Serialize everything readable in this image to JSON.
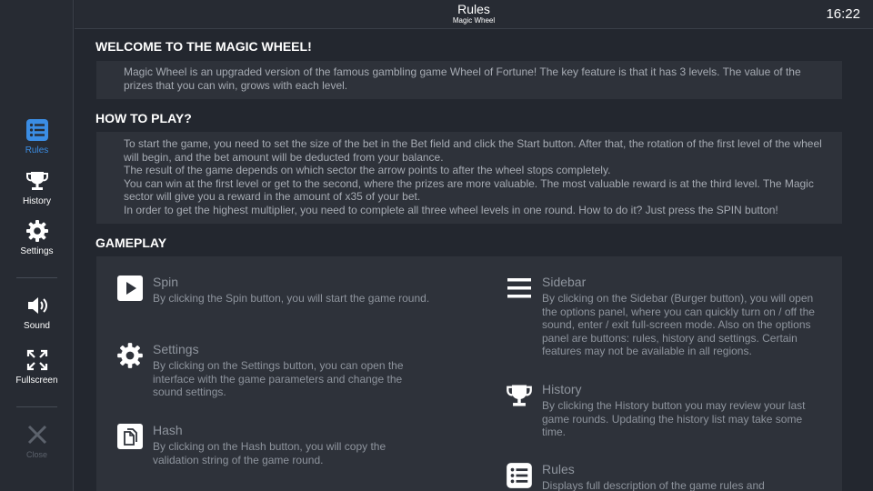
{
  "sidebar": {
    "items": [
      {
        "label": "Rules",
        "icon": "rules-list-icon",
        "active": true
      },
      {
        "label": "History",
        "icon": "trophy-icon"
      },
      {
        "label": "Settings",
        "icon": "gear-icon"
      },
      {
        "label": "Sound",
        "icon": "speaker-icon"
      },
      {
        "label": "Fullscreen",
        "icon": "fullscreen-icon"
      },
      {
        "label": "Close",
        "icon": "close-icon",
        "disabled": true
      }
    ]
  },
  "header": {
    "title": "Rules",
    "subtitle": "Magic Wheel",
    "clock": "16:22"
  },
  "sections": {
    "welcome": {
      "title": "WELCOME TO THE MAGIC WHEEL!",
      "text": "Magic Wheel is an upgraded version of the famous gambling game Wheel of Fortune! The key feature is that it has 3 levels. The value of the prizes that you can win, grows with each level."
    },
    "how_to_play": {
      "title": "HOW TO PLAY?",
      "lines": [
        "To start the game, you need to set the size of the bet in the Bet field and click the Start button. After that, the rotation of the first level of the wheel will begin, and the bet amount will be deducted from your balance.",
        "The result of the game depends on which sector the arrow points to after the wheel stops completely.",
        "You can win at the first level or get to the second, where the prizes are more valuable. The most valuable reward is at the third level. The Magic sector will give you a reward in the amount of x35 of your bet.",
        "In order to get the highest multiplier, you need to complete all three wheel levels in one round. How to do it? Just press the SPIN button!"
      ]
    },
    "gameplay": {
      "title": "GAMEPLAY",
      "left": [
        {
          "title": "Spin",
          "icon": "play-icon",
          "desc": "By clicking the Spin button, you will start the game round."
        },
        {
          "title": "Settings",
          "icon": "gear-icon",
          "desc": "By clicking on the Settings button, you can open the interface with the game parameters and change the sound settings."
        },
        {
          "title": "Hash",
          "icon": "copy-icon",
          "desc": "By clicking on the Hash button, you will copy the validation string of the game round."
        }
      ],
      "right": [
        {
          "title": "Sidebar",
          "icon": "burger-menu-icon",
          "desc": "By clicking on the Sidebar (Burger button), you will open the options panel, where you can quickly turn on / off the sound, enter / exit full-screen mode. Also on the options panel are buttons: rules, history and settings. Certain features may not be available in all regions."
        },
        {
          "title": "History",
          "icon": "trophy-icon",
          "desc": "By clicking the History button you may review your last game rounds. Updating the history list may take some time."
        },
        {
          "title": "Rules",
          "icon": "rules-list-icon",
          "desc": "Displays full description of the game rules and"
        }
      ]
    }
  },
  "colors": {
    "background": "#23272f",
    "panel": "#2e323a",
    "accent": "#3b8de4"
  }
}
